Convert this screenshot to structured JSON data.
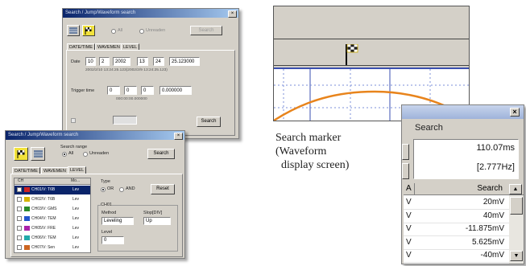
{
  "caption": {
    "line1": "Search marker",
    "line2": "(Waveform",
    "line3": "  display screen)"
  },
  "dialog1": {
    "title": "Search / Jump/Waveform search",
    "close": "×",
    "radio_labels": [
      "All",
      "Unreaden"
    ],
    "top_button": "Search",
    "tabs": [
      "DATE/TIME",
      "WAVEMEN",
      "LEVEL"
    ],
    "date_label": "Date",
    "date_fields": [
      "10",
      "2",
      "2002",
      "13",
      "24",
      "25.123000"
    ],
    "date_hint": "2002/2/10 13:24:25.123(2002/2/9 13:24:25.123)",
    "trigger_label": "Trigger time",
    "trigger_fields": [
      "0",
      "0",
      "0",
      "0.000000"
    ],
    "trigger_hint": "000:00:00.000000",
    "search_button": "Search"
  },
  "dialog2": {
    "title": "Search / Jump/Waveform search",
    "close": "×",
    "search_range_label": "Search range",
    "radio_labels": [
      "All",
      "Unreaden"
    ],
    "search_button": "Search",
    "tabs": [
      "DATE/TIME",
      "WAVEMEN",
      "LEVEL"
    ],
    "list_headers": [
      "CH",
      "Mo..."
    ],
    "channels": [
      {
        "name": "CH01/V: T6B",
        "mode": "Lev",
        "color": "#cc2222"
      },
      {
        "name": "CH02/V: T6B",
        "mode": "Lev",
        "color": "#d4b400"
      },
      {
        "name": "CH03/V: GMS",
        "mode": "Lev",
        "color": "#2a8a2a"
      },
      {
        "name": "CH04/V: TEM",
        "mode": "Lev",
        "color": "#2255cc"
      },
      {
        "name": "CH05/V: FRE",
        "mode": "Lev",
        "color": "#aa22aa"
      },
      {
        "name": "CH06/V: TEM",
        "mode": "Lev",
        "color": "#22aaaa"
      },
      {
        "name": "CH07/V: Sen",
        "mode": "Lev",
        "color": "#cc6622"
      }
    ],
    "type_label": "Type",
    "type_options": [
      "OR",
      "AND"
    ],
    "reset_button": "Reset",
    "method_group": "CH01",
    "method_label": "Method",
    "method_value": "Leveling",
    "slope_label": "Slop[DIV]",
    "slope_value": "Up",
    "level_label": "Level",
    "level_value": "0"
  },
  "waveform": {
    "marker_icon": "checkered-flag-icon"
  },
  "panel": {
    "close": "×",
    "header": "Search",
    "time_value": "110.07ms",
    "freq_value": "[2.777Hz]",
    "col_left": "A",
    "col_search": "Search",
    "rows": [
      {
        "left": "V",
        "value": "20mV"
      },
      {
        "left": "V",
        "value": "40mV"
      },
      {
        "left": "V",
        "value": "-11.875mV"
      },
      {
        "left": "V",
        "value": "5.625mV"
      },
      {
        "left": "V",
        "value": "-40mV"
      }
    ]
  }
}
